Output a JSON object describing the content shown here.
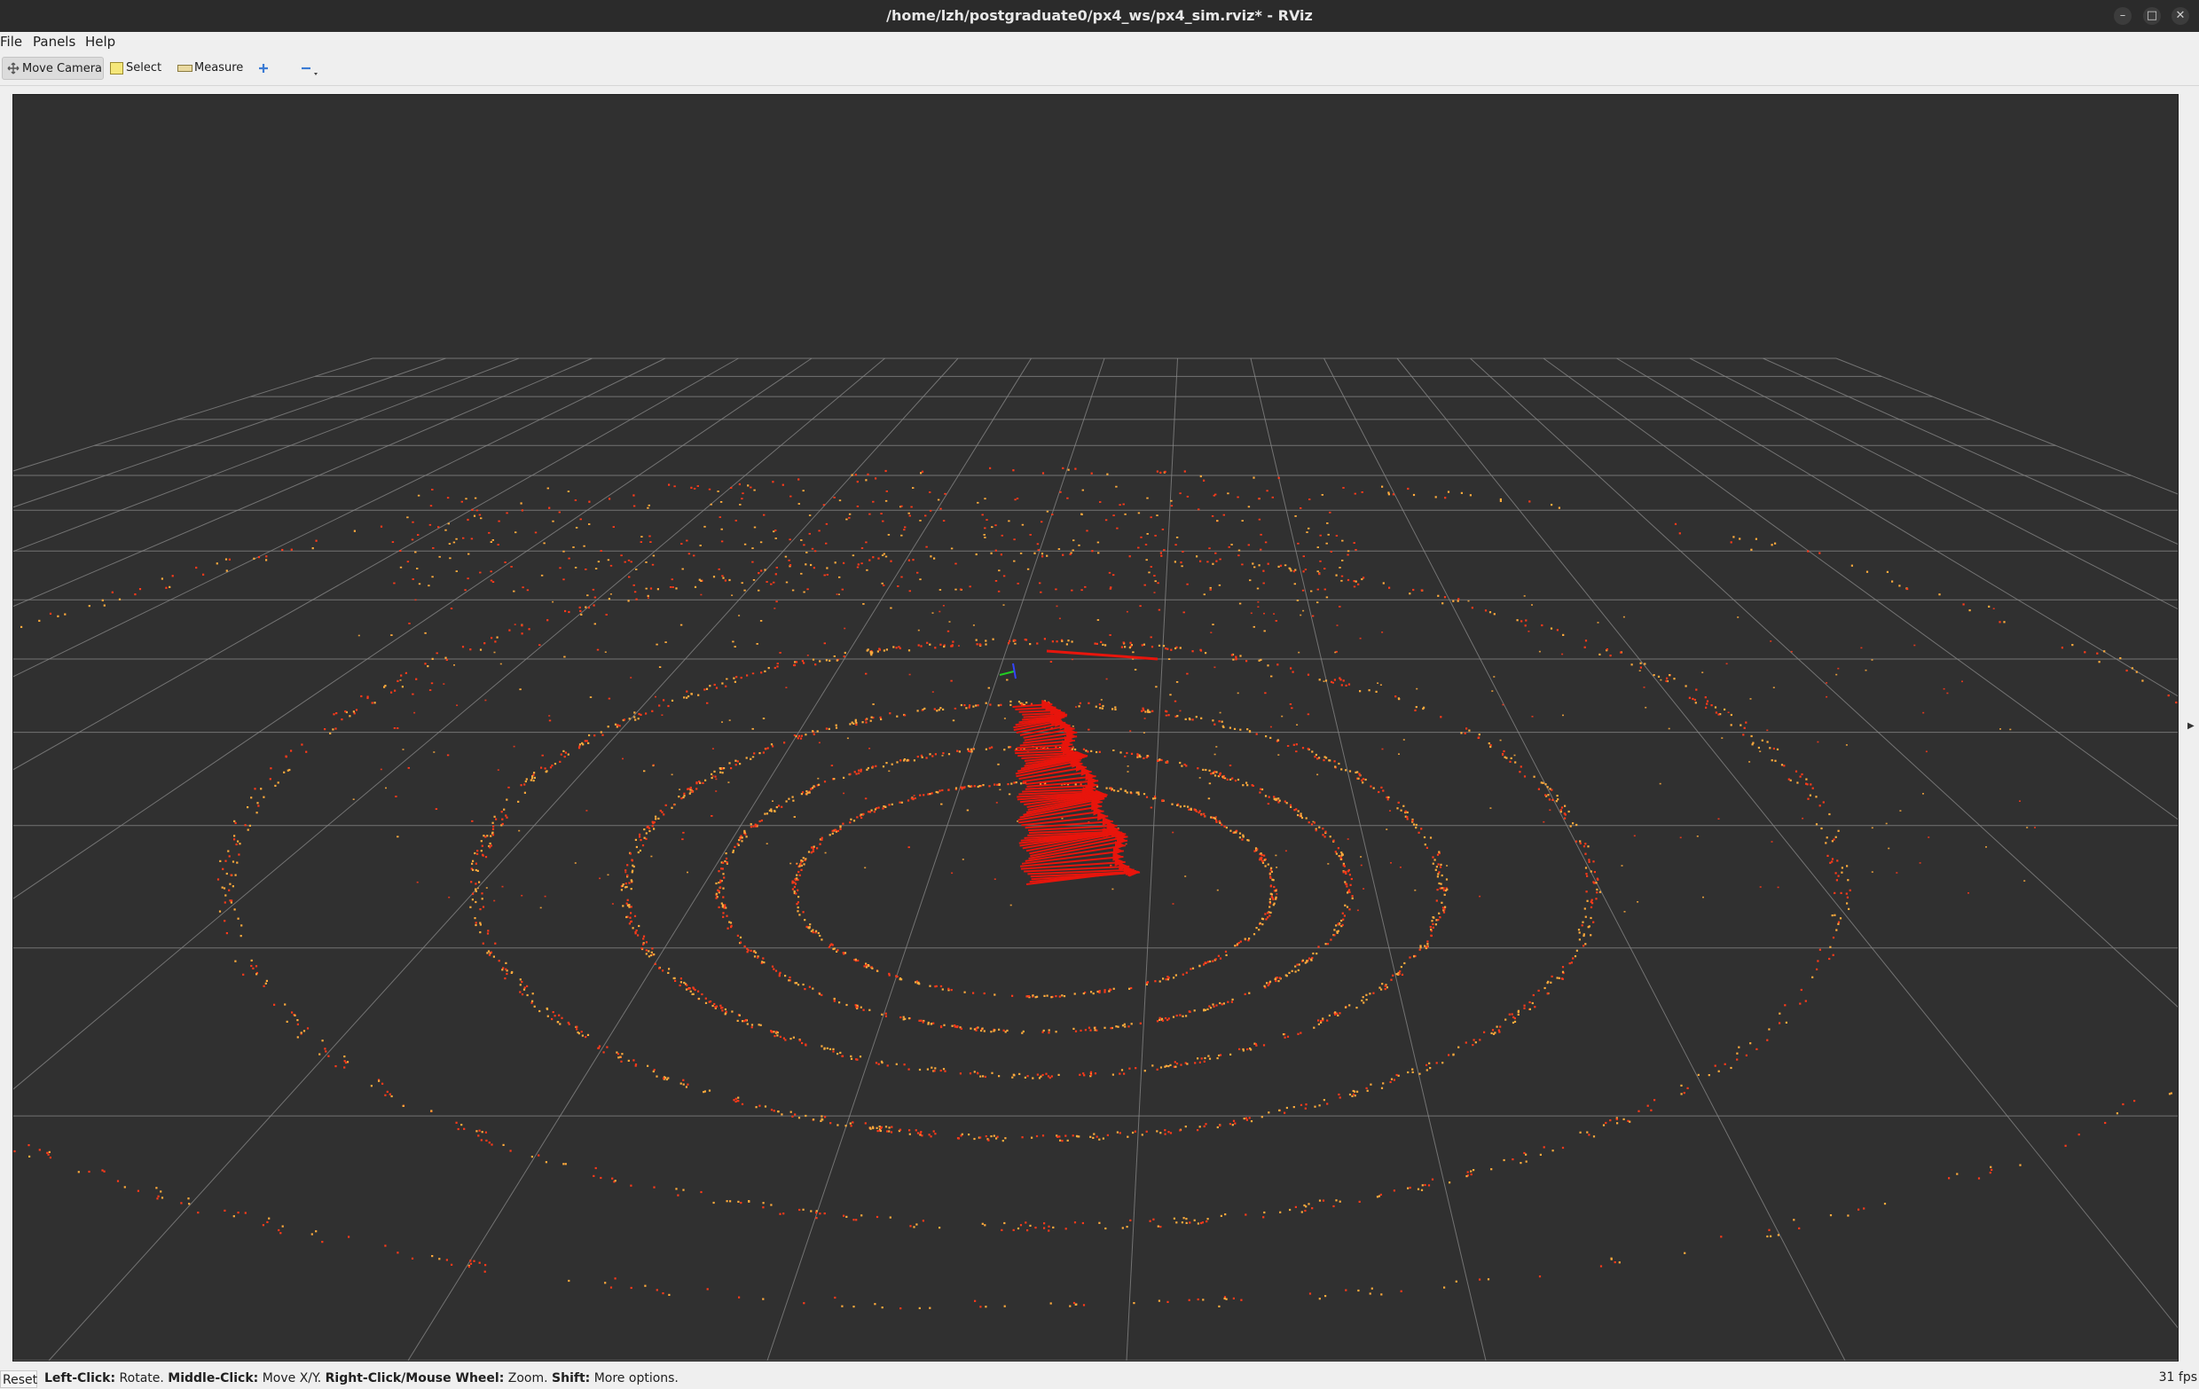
{
  "window": {
    "title": "/home/lzh/postgraduate0/px4_ws/px4_sim.rviz* - RViz",
    "minimize": "–",
    "maximize": "□",
    "close": "✕"
  },
  "menu": [
    "File",
    "Panels",
    "Help"
  ],
  "toolbar": {
    "move_camera": "Move Camera",
    "select": "Select",
    "measure": "Measure",
    "add_icon": "plus-icon",
    "remove_icon": "minus-icon"
  },
  "status": {
    "reset": "Reset",
    "hint_parts": [
      {
        "b": "Left-Click:",
        "t": " Rotate. "
      },
      {
        "b": "Middle-Click:",
        "t": " Move X/Y. "
      },
      {
        "b": "Right-Click/Mouse Wheel:",
        "t": " Zoom. "
      },
      {
        "b": "Shift:",
        "t": " More options."
      }
    ],
    "fps": "31 fps"
  },
  "colors": {
    "viewport_bg": "#303030",
    "grid": "#8a8a8a",
    "pointcloud_red": "#ff3a1a",
    "pointcloud_orange": "#ffab3c",
    "arrows": "#e8150c"
  }
}
